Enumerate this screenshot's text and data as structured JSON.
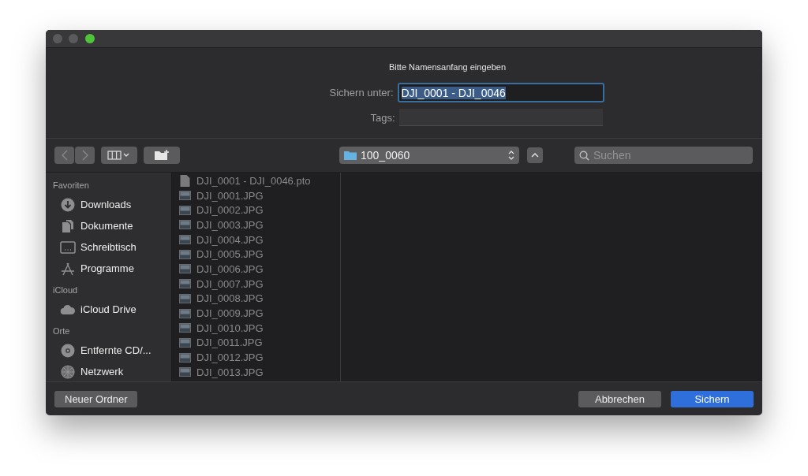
{
  "dialog": {
    "message": "Bitte Namensanfang eingeben"
  },
  "save_as": {
    "label": "Sichern unter:",
    "value": "DJI_0001 - DJI_0046",
    "text_selected": true
  },
  "tags": {
    "label": "Tags:"
  },
  "toolbar": {
    "location": "100_0060",
    "search": {
      "placeholder": "Suchen"
    }
  },
  "sidebar": [
    {
      "heading": "Favoriten",
      "items": [
        {
          "label": "Downloads",
          "kind": "download"
        },
        {
          "label": "Dokumente",
          "kind": "documents"
        },
        {
          "label": "Schreibtisch",
          "kind": "desktop"
        },
        {
          "label": "Programme",
          "kind": "apps"
        }
      ]
    },
    {
      "heading": "iCloud",
      "items": [
        {
          "label": "iCloud Drive",
          "kind": "cloud"
        }
      ]
    },
    {
      "heading": "Orte",
      "items": [
        {
          "label": "Entfernte CD/...",
          "kind": "disc"
        },
        {
          "label": "Netzwerk",
          "kind": "network"
        }
      ]
    }
  ],
  "files": [
    {
      "name": "DJI_0001 - DJI_0046.pto",
      "kind": "document"
    },
    {
      "name": "DJI_0001.JPG",
      "kind": "image"
    },
    {
      "name": "DJI_0002.JPG",
      "kind": "image"
    },
    {
      "name": "DJI_0003.JPG",
      "kind": "image"
    },
    {
      "name": "DJI_0004.JPG",
      "kind": "image"
    },
    {
      "name": "DJI_0005.JPG",
      "kind": "image"
    },
    {
      "name": "DJI_0006.JPG",
      "kind": "image"
    },
    {
      "name": "DJI_0007.JPG",
      "kind": "image"
    },
    {
      "name": "DJI_0008.JPG",
      "kind": "image"
    },
    {
      "name": "DJI_0009.JPG",
      "kind": "image"
    },
    {
      "name": "DJI_0010.JPG",
      "kind": "image"
    },
    {
      "name": "DJI_0011.JPG",
      "kind": "image"
    },
    {
      "name": "DJI_0012.JPG",
      "kind": "image"
    },
    {
      "name": "DJI_0013.JPG",
      "kind": "image"
    }
  ],
  "buttons": {
    "new_folder": "Neuer Ordner",
    "cancel": "Abbrechen",
    "save": "Sichern"
  }
}
